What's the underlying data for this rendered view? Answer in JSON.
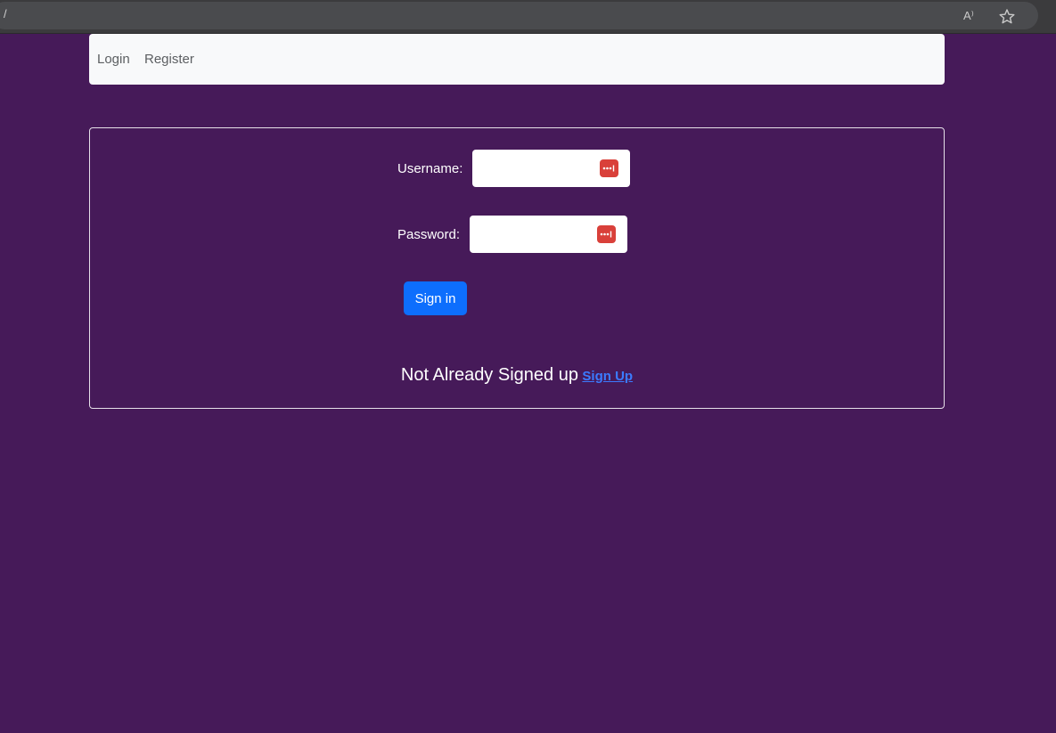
{
  "browser": {
    "address_text": "/",
    "read_aloud_label": "A⁾"
  },
  "nav": {
    "items": [
      {
        "label": "Login"
      },
      {
        "label": "Register"
      }
    ]
  },
  "form": {
    "username_label": "Username:",
    "username_value": "",
    "password_label": "Password:",
    "password_value": "",
    "submit_label": "Sign in"
  },
  "signup": {
    "text": "Not Already Signed up",
    "link_label": "Sign Up"
  },
  "colors": {
    "page_background": "#461a59",
    "primary_button": "#0d6efd",
    "password_manager_icon": "#d9403a",
    "navbar_background": "#f8f9fa"
  },
  "icons": {
    "address_bar": [
      "read-aloud-icon",
      "star-icon"
    ],
    "input": "password-manager-icon"
  }
}
